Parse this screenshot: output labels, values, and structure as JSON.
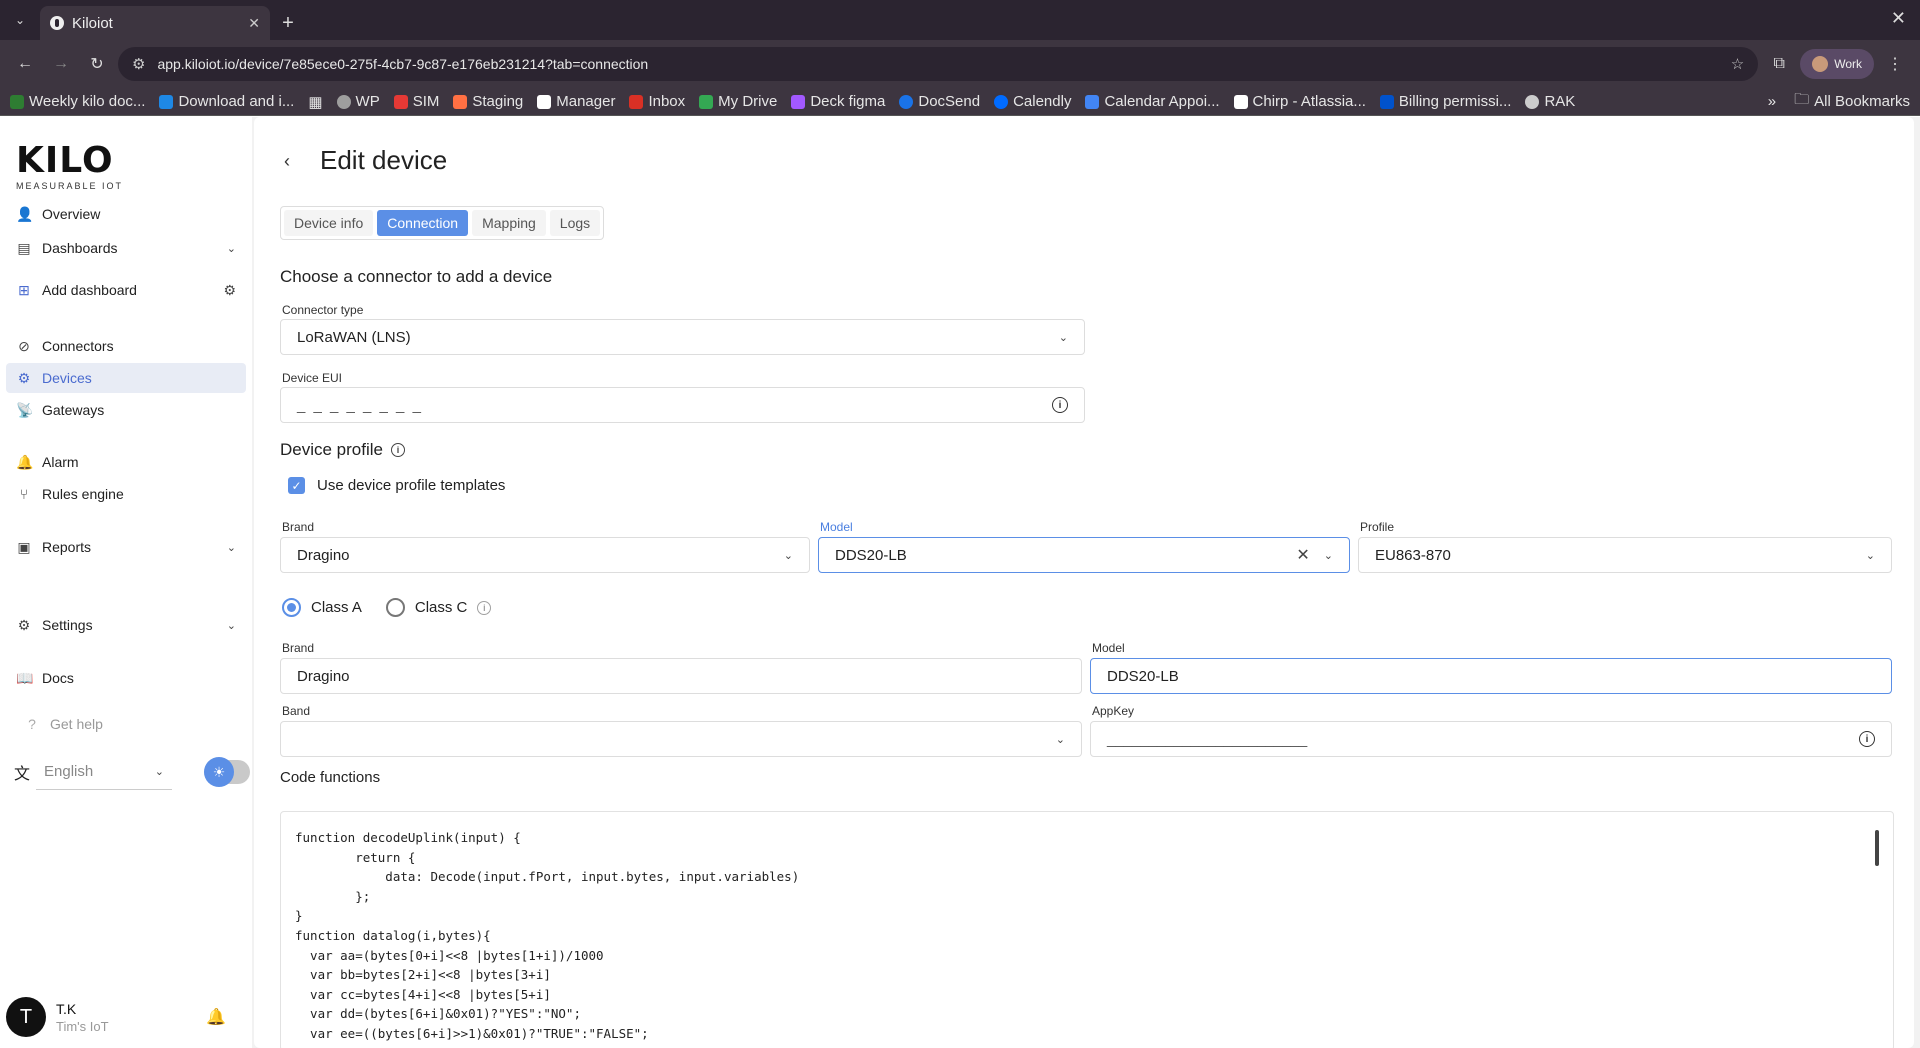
{
  "browser": {
    "tab_title": "Kiloiot",
    "url": "app.kiloiot.io/device/7e85ece0-275f-4cb7-9c87-e176eb231214?tab=connection",
    "profile_label": "Work",
    "bookmarks": [
      {
        "label": "Weekly kilo doc...",
        "color": "#2e7d32"
      },
      {
        "label": "Download and i...",
        "color": "#1e88e5"
      },
      {
        "label": "",
        "color": "#888888"
      },
      {
        "label": "WP",
        "color": "#9e9e9e"
      },
      {
        "label": "SIM",
        "color": "#e53935"
      },
      {
        "label": "Staging",
        "color": "#ff7043"
      },
      {
        "label": "Manager",
        "color": "#212121"
      },
      {
        "label": "Inbox",
        "color": "#d93025"
      },
      {
        "label": "My Drive",
        "color": "#34a853"
      },
      {
        "label": "Deck figma",
        "color": "#a259ff"
      },
      {
        "label": "DocSend",
        "color": "#1a73e8"
      },
      {
        "label": "Calendly",
        "color": "#006bff"
      },
      {
        "label": "Calendar Appoi...",
        "color": "#4285f4"
      },
      {
        "label": "Chirp - Atlassia...",
        "color": "#ffffff"
      },
      {
        "label": "Billing permissi...",
        "color": "#0052cc"
      },
      {
        "label": "RAK",
        "color": "#cccccc"
      }
    ],
    "all_bookmarks": "All Bookmarks"
  },
  "sidebar": {
    "logo": "KILO",
    "tagline": "MEASURABLE IOT",
    "items": [
      {
        "label": "Overview"
      },
      {
        "label": "Dashboards"
      },
      {
        "label": "Add dashboard"
      },
      {
        "label": "Connectors"
      },
      {
        "label": "Devices"
      },
      {
        "label": "Gateways"
      },
      {
        "label": "Alarm"
      },
      {
        "label": "Rules engine"
      },
      {
        "label": "Reports"
      },
      {
        "label": "Settings"
      },
      {
        "label": "Docs"
      },
      {
        "label": "Get help"
      }
    ],
    "language": "English",
    "user": {
      "initial": "T",
      "name": "T.K",
      "org": "Tim's IoT"
    }
  },
  "page": {
    "title": "Edit device",
    "tabs": [
      "Device info",
      "Connection",
      "Mapping",
      "Logs"
    ],
    "connector_heading": "Choose a connector to add a device",
    "connector_type_label": "Connector type",
    "connector_type_value": "LoRaWAN (LNS)",
    "device_eui_label": "Device EUI",
    "device_eui_value": "_ _ _ _ _ _ _ _",
    "device_profile_heading": "Device profile",
    "use_templates_label": "Use device profile templates",
    "template": {
      "brand_label": "Brand",
      "brand_value": "Dragino",
      "model_label": "Model",
      "model_value": "DDS20-LB",
      "profile_label": "Profile",
      "profile_value": "EU863-870"
    },
    "class_a": "Class A",
    "class_c": "Class C",
    "details": {
      "brand_label": "Brand",
      "brand_value": "Dragino",
      "model_label": "Model",
      "model_value": "DDS20-LB",
      "band_label": "Band",
      "band_value": "",
      "appkey_label": "AppKey",
      "appkey_value": "________________________"
    },
    "code_heading": "Code functions",
    "code": "function decodeUplink(input) {\n        return {\n            data: Decode(input.fPort, input.bytes, input.variables)\n        };\n}\nfunction datalog(i,bytes){\n  var aa=(bytes[0+i]<<8 |bytes[1+i])/1000\n  var bb=bytes[2+i]<<8 |bytes[3+i]\n  var cc=bytes[4+i]<<8 |bytes[5+i]\n  var dd=(bytes[6+i]&0x01)?\"YES\":\"NO\";\n  var ee=((bytes[6+i]>>1)&0x01)?\"TRUE\":\"FALSE\";"
  },
  "colors": {
    "accent": "#5b8fe6",
    "active_nav_bg": "#e8ecf5"
  }
}
